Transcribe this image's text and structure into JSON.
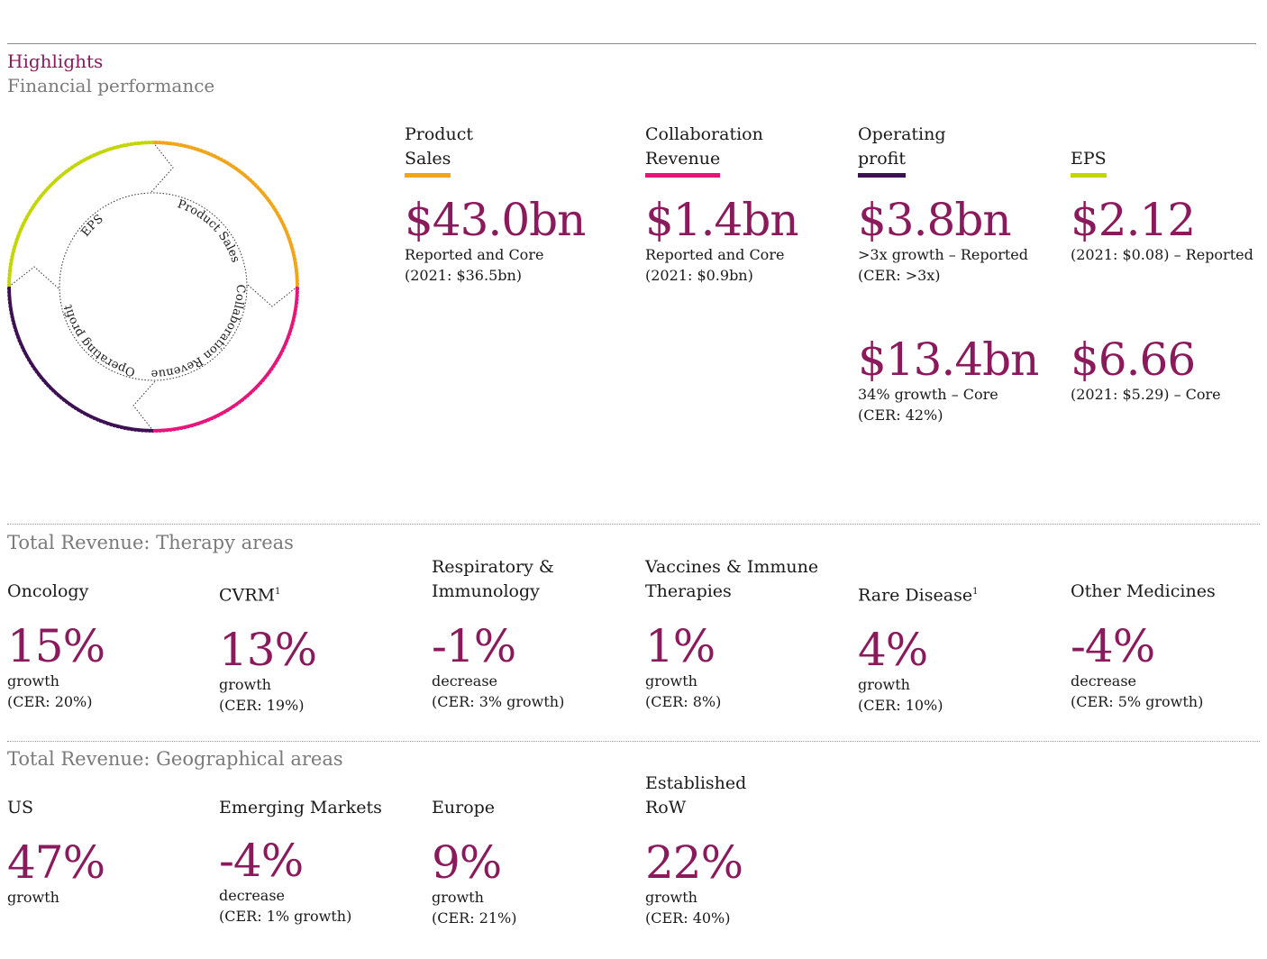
{
  "header": {
    "title": "Highlights",
    "subtitle": "Financial performance"
  },
  "wheel": {
    "segments": [
      "Product Sales",
      "Collaboration Revenue",
      "Operating profit",
      "EPS"
    ],
    "colors": {
      "product_sales": "#f0a51b",
      "collaboration": "#e5157a",
      "operating": "#3c1053",
      "eps": "#c4d600"
    }
  },
  "kpis": [
    {
      "label_line1": "Product",
      "label_line2": "Sales",
      "value": "$43.0bn",
      "note1": "Reported and Core",
      "note2": "(2021: $36.5bn)",
      "underline": "#f0a51b"
    },
    {
      "label_line1": "Collaboration",
      "label_line2": "Revenue",
      "value": "$1.4bn",
      "note1": "Reported and Core",
      "note2": "(2021: $0.9bn)",
      "underline": "#e5157a"
    },
    {
      "label_line1": "Operating",
      "label_line2": "profit",
      "value": "$3.8bn",
      "note1": ">3x growth – Reported",
      "note2": "(CER: >3x)",
      "value2": "$13.4bn",
      "note3": "34% growth – Core",
      "note4": "(CER: 42%)",
      "underline": "#3c1053"
    },
    {
      "label_line1": "",
      "label_line2": "EPS",
      "value": "$2.12",
      "note1": "(2021: $0.08) – Reported",
      "value2": "$6.66",
      "note3": "(2021: $5.29) – Core",
      "underline": "#c4d600"
    }
  ],
  "therapy": {
    "title": "Total Revenue: Therapy areas",
    "items": [
      {
        "label1": "",
        "label2": "Oncology",
        "sup": "",
        "pct": "15%",
        "word": "growth",
        "cer": "(CER: 20%)"
      },
      {
        "label1": "",
        "label2": "CVRM",
        "sup": "1",
        "pct": "13%",
        "word": "growth",
        "cer": "(CER: 19%)"
      },
      {
        "label1": "Respiratory &",
        "label2": "Immunology",
        "sup": "",
        "pct": "-1%",
        "word": "decrease",
        "cer": "(CER: 3% growth)"
      },
      {
        "label1": "Vaccines & Immune",
        "label2": "Therapies",
        "sup": "",
        "pct": "1%",
        "word": "growth",
        "cer": "(CER: 8%)"
      },
      {
        "label1": "",
        "label2": "Rare Disease",
        "sup": "1",
        "pct": "4%",
        "word": "growth",
        "cer": "(CER: 10%)"
      },
      {
        "label1": "",
        "label2": "Other Medicines",
        "sup": "",
        "pct": "-4%",
        "word": "decrease",
        "cer": "(CER: 5% growth)"
      }
    ]
  },
  "geo": {
    "title": "Total Revenue: Geographical areas",
    "items": [
      {
        "label1": "",
        "label2": "US",
        "pct": "47%",
        "word": "growth",
        "cer": ""
      },
      {
        "label1": "",
        "label2": "Emerging Markets",
        "pct": "-4%",
        "word": "decrease",
        "cer": "(CER: 1% growth)"
      },
      {
        "label1": "",
        "label2": "Europe",
        "pct": "9%",
        "word": "growth",
        "cer": "(CER: 21%)"
      },
      {
        "label1": "Established",
        "label2": "RoW",
        "pct": "22%",
        "word": "growth",
        "cer": "(CER: 40%)"
      }
    ]
  }
}
